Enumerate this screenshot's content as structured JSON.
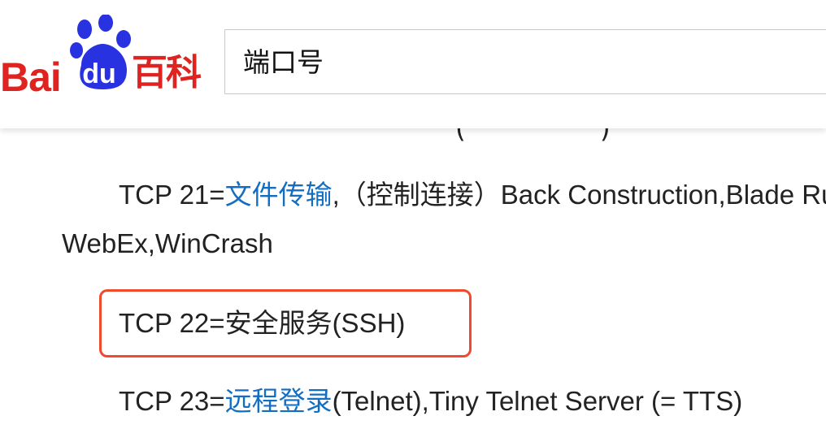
{
  "header": {
    "logo": {
      "bai_text": "Bai",
      "du_text": "du",
      "baike_text": "百科",
      "brand_red": "#de2321",
      "brand_blue": "#2932e1"
    },
    "search": {
      "value": "端口号"
    }
  },
  "content": {
    "prev_fragment": "(　　　　　)",
    "ports": [
      {
        "prefix": "TCP 21=",
        "link": "文件传输",
        "suffix": ",（控制连接）Back Construction,Blade Runner",
        "continuation": "WebEx,WinCrash"
      },
      {
        "prefix": "TCP 22=",
        "text": "安全服务(SSH)"
      },
      {
        "prefix": "TCP 23=",
        "link": "远程登录",
        "suffix": "(Telnet),Tiny Telnet Server (= TTS)"
      }
    ],
    "link_color": "#136ec2",
    "highlight_color": "#f04a2c"
  }
}
